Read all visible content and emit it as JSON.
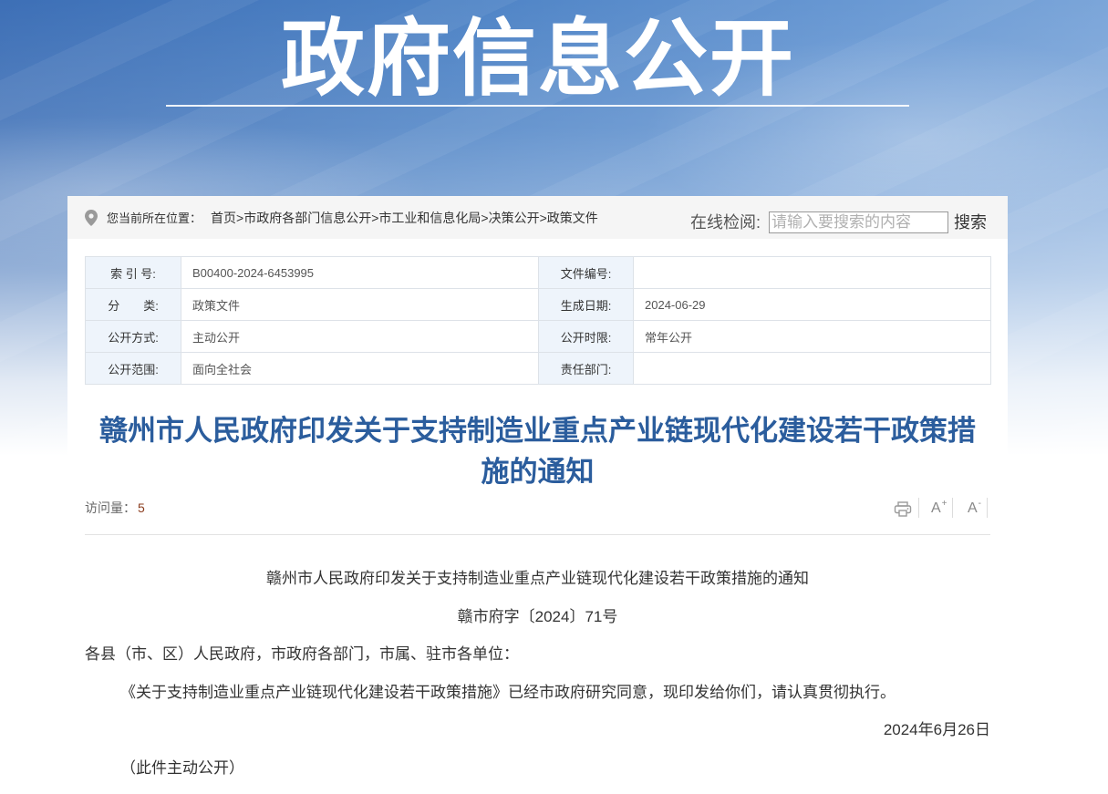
{
  "banner": {
    "title": "政府信息公开"
  },
  "icons": {
    "location": "location-pin-icon",
    "print": "print-icon",
    "font_increase": "font-increase-icon",
    "font_decrease": "font-decrease-icon"
  },
  "colors": {
    "banner_blue": "#3d6fb6",
    "breadcrumb_bg": "#f5f5f5",
    "label_cell_bg": "#eef4fb",
    "title_blue": "#2b5d9d",
    "visits_count_color": "#8b3c1e"
  },
  "breadcrumb": {
    "prefix": "您当前所在位置：",
    "separator": ">",
    "items": [
      "首页",
      "市政府各部门信息公开",
      "市工业和信息化局",
      "决策公开",
      "政策文件"
    ]
  },
  "search": {
    "label": "在线检阅:",
    "placeholder": "请输入要搜索的内容",
    "value": "",
    "button": "搜索"
  },
  "info_table": {
    "rows": [
      [
        {
          "label": "索 引 号:",
          "value": "B00400-2024-6453995"
        },
        {
          "label": "文件编号:",
          "value": ""
        }
      ],
      [
        {
          "label": "分　　类:",
          "value": "政策文件"
        },
        {
          "label": "生成日期:",
          "value": "2024-06-29"
        }
      ],
      [
        {
          "label": "公开方式:",
          "value": "主动公开"
        },
        {
          "label": "公开时限:",
          "value": "常年公开"
        }
      ],
      [
        {
          "label": "公开范围:",
          "value": "面向全社会"
        },
        {
          "label": "责任部门:",
          "value": ""
        }
      ]
    ]
  },
  "article": {
    "title": "赣州市人民政府印发关于支持制造业重点产业链现代化建设若干政策措施的通知",
    "visits_label": "访问量：",
    "visits_count": "5",
    "tools": {
      "font_increase": {
        "letter": "A",
        "sign": "+"
      },
      "font_decrease": {
        "letter": "A",
        "sign": "-"
      }
    },
    "body": {
      "heading": "赣州市人民政府印发关于支持制造业重点产业链现代化建设若干政策措施的通知",
      "doc_number": "赣市府字〔2024〕71号",
      "salutation": "各县（市、区）人民政府，市政府各部门，市属、驻市各单位：",
      "paragraph": "《关于支持制造业重点产业链现代化建设若干政策措施》已经市政府研究同意，现印发给你们，请认真贯彻执行。",
      "date": "2024年6月26日",
      "note": "（此件主动公开）"
    }
  }
}
